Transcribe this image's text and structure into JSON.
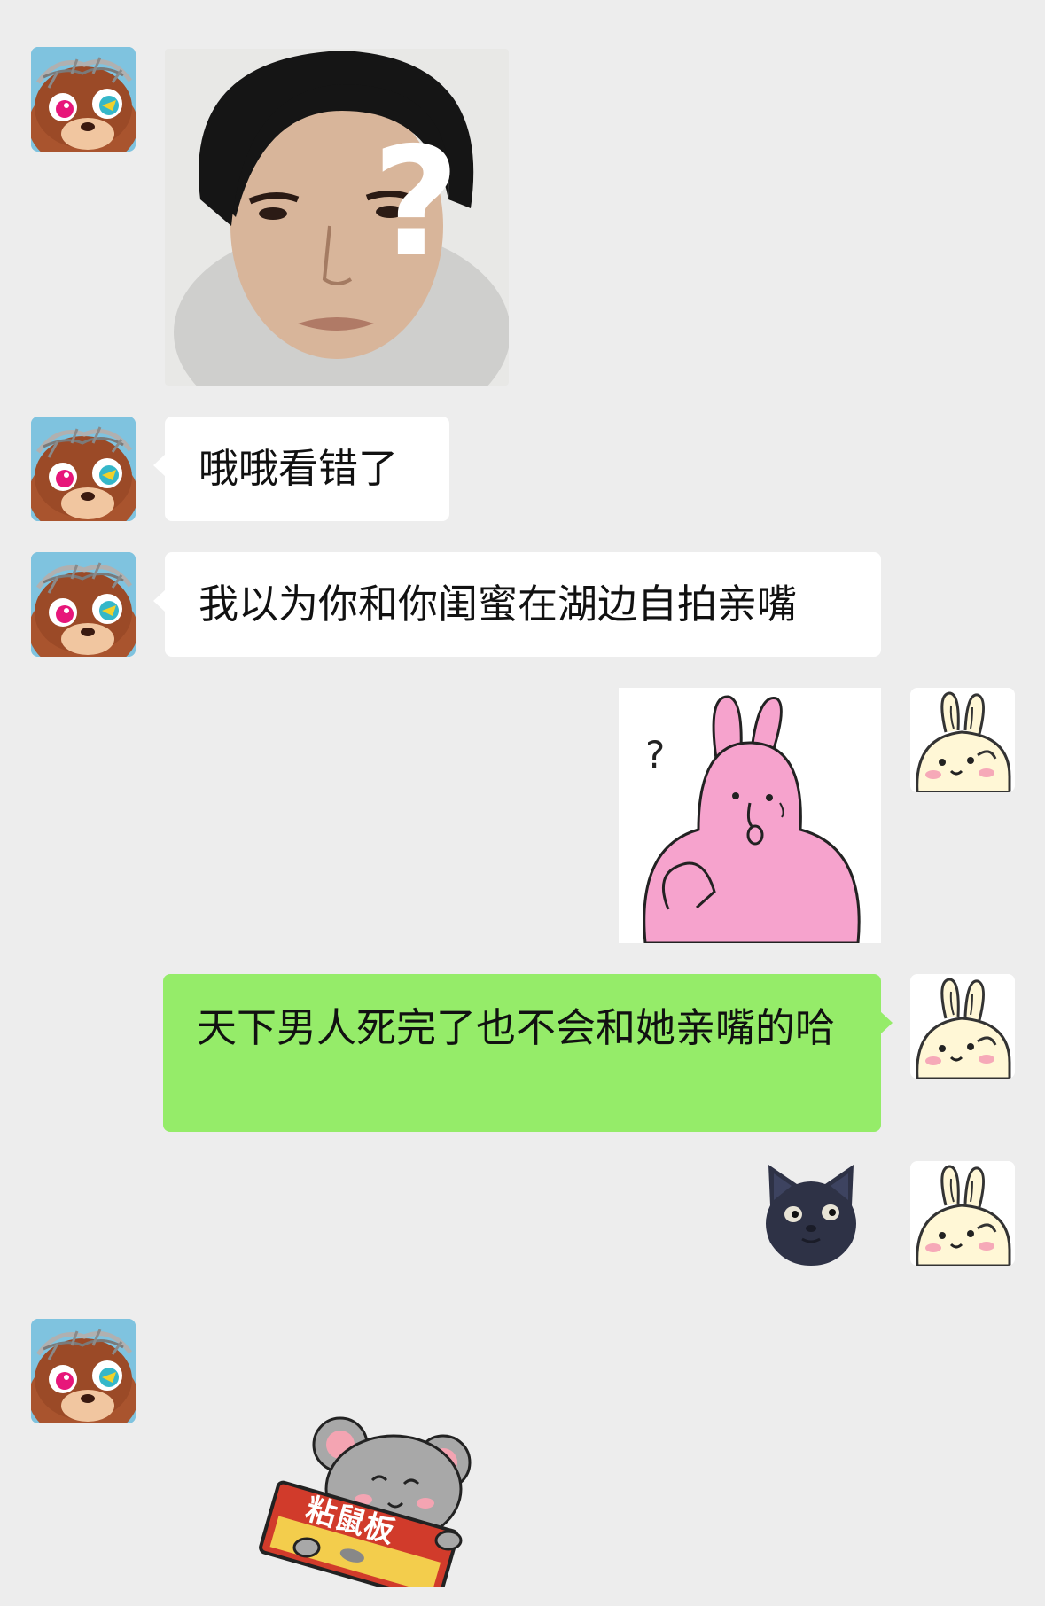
{
  "messages": [
    {
      "side": "left",
      "kind": "image",
      "content": "confused-man-question-mark-photo"
    },
    {
      "side": "left",
      "kind": "text",
      "text": "哦哦看错了"
    },
    {
      "side": "left",
      "kind": "text",
      "text": "我以为你和你闺蜜在湖边自拍亲嘴"
    },
    {
      "side": "right",
      "kind": "sticker",
      "content": "pink-bunny-question-sticker",
      "label": "?"
    },
    {
      "side": "right",
      "kind": "text",
      "text": "天下男人死完了也不会和她亲嘴的哈"
    },
    {
      "side": "right",
      "kind": "emoji",
      "content": "dark-cat-face-emoji"
    },
    {
      "side": "left",
      "kind": "sticker",
      "content": "mouse-glue-board-sticker",
      "label": "粘鼠板"
    }
  ],
  "sticker_text": {
    "question_mark": "?",
    "glue_board": "粘鼠板"
  },
  "avatars": {
    "left": "bear-avatar",
    "right": "bunny-avatar"
  },
  "colors": {
    "background": "#ededed",
    "left_bubble": "#ffffff",
    "right_bubble": "#95ec69",
    "text": "#111111"
  }
}
